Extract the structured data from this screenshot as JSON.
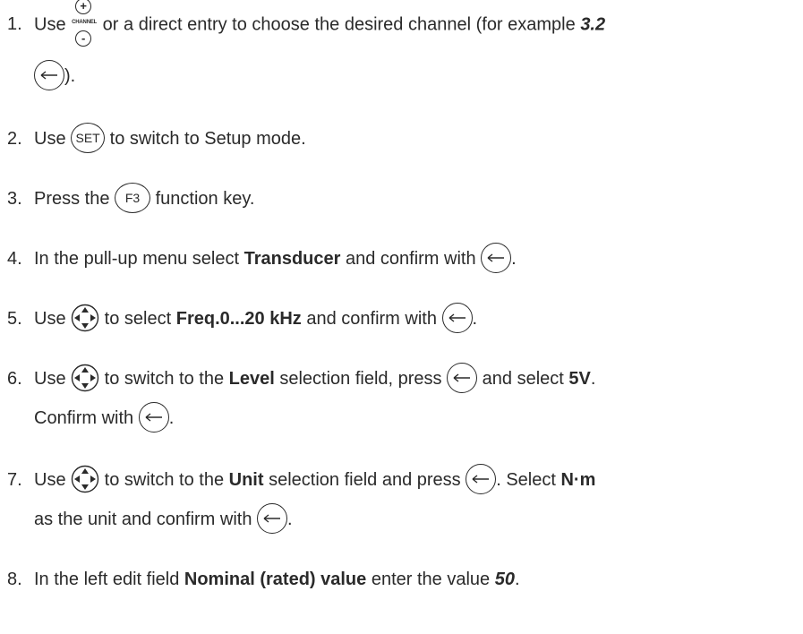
{
  "steps": [
    {
      "n": "1.",
      "a": "Use ",
      "chan_label": "CHANNEL",
      "chan_plus": "+",
      "chan_minus": "-",
      "b": " or a direct entry to choose the desired channel (for example ",
      "example": "3.2",
      "c": ")."
    },
    {
      "n": "2.",
      "a": "Use ",
      "key": "SET",
      "b": " to switch to Setup mode."
    },
    {
      "n": "3.",
      "a": "Press the ",
      "key": "F3",
      "b": " function key."
    },
    {
      "n": "4.",
      "a": "In the pull-up menu select ",
      "bold": "Transducer",
      "b": " and confirm with ",
      "c": "."
    },
    {
      "n": "5.",
      "a": "Use ",
      "b": " to select ",
      "bold": "Freq.0...20 kHz",
      "c": " and confirm with ",
      "d": "."
    },
    {
      "n": "6.",
      "a": "Use ",
      "b": " to switch to the ",
      "bold1": "Level",
      "c": " selection field, press ",
      "d": " and select ",
      "bold2": "5V",
      "e": ".",
      "f": "Confirm with ",
      "g": "."
    },
    {
      "n": "7.",
      "a": "Use ",
      "b": " to switch to the ",
      "bold1": "Unit",
      "c": " selection field and press ",
      "d": ". Select ",
      "bold2": "N·m",
      "e": "as the unit and confirm with ",
      "f": "."
    },
    {
      "n": "8.",
      "a": "In the left edit field ",
      "bold": "Nominal (rated) value",
      "b": " enter the value ",
      "value": "50",
      "c": "."
    }
  ],
  "icons": {
    "enter": "enter-key-icon",
    "nav": "navigation-cross-icon",
    "channel": "channel-plus-minus-icon"
  }
}
